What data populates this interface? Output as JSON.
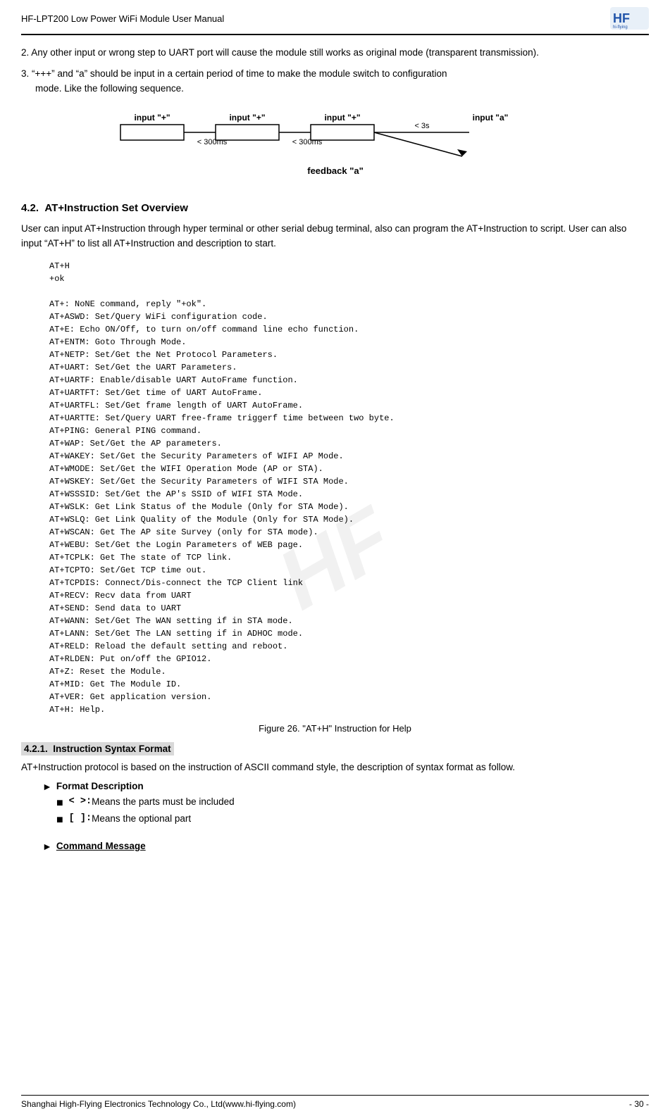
{
  "header": {
    "title": "HF-LPT200 Low Power WiFi Module User Manual",
    "logo_alt": "HF logo"
  },
  "footer": {
    "company": "Shanghai High-Flying Electronics Technology Co., Ltd(www.hi-flying.com)",
    "page": "- 30 -"
  },
  "watermark": "HF",
  "body": {
    "para1": "2. Any other input or wrong step to UART port will cause the module still works as original mode (transparent transmission).",
    "para2_a": "3. “+++” and “a” should be input in a certain period of time to make the module switch to configuration",
    "para2_b": "mode. Like the following sequence.",
    "section_4_2_number": "4.2.",
    "section_4_2_title": "AT+Instruction Set Overview",
    "section_4_2_body": "User can input AT+Instruction through hyper terminal or other serial debug terminal, also can program the AT+Instruction to script. User can also input “AT+H” to list all AT+Instruction and description to start.",
    "code_header": "AT+H\n+ok",
    "code_body": "\nAT+: NoNE command, reply \"+ok\".\nAT+ASWD: Set/Query WiFi configuration code.\nAT+E: Echo ON/Off, to turn on/off command line echo function.\nAT+ENTM: Goto Through Mode.\nAT+NETP: Set/Get the Net Protocol Parameters.\nAT+UART: Set/Get the UART Parameters.\nAT+UARTF: Enable/disable UART AutoFrame function.\nAT+UARTFT: Set/Get time of UART AutoFrame.\nAT+UARTFL: Set/Get frame length of UART AutoFrame.\nAT+UARTTE: Set/Query UART free-frame triggerf time between two byte.\nAT+PING: General PING command.\nAT+WAP: Set/Get the AP parameters.\nAT+WAKEY: Set/Get the Security Parameters of WIFI AP Mode.\nAT+WMODE: Set/Get the WIFI Operation Mode (AP or STA).\nAT+WSKEY: Set/Get the Security Parameters of WIFI STA Mode.\nAT+WSSSID: Set/Get the AP's SSID of WIFI STA Mode.\nAT+WSLK: Get Link Status of the Module (Only for STA Mode).\nAT+WSLQ: Get Link Quality of the Module (Only for STA Mode).\nAT+WSCAN: Get The AP site Survey (only for STA mode).\nAT+WEBU: Set/Get the Login Parameters of WEB page.\nAT+TCPLK: Get The state of TCP link.\nAT+TCPTO: Set/Get TCP time out.\nAT+TCPDIS: Connect/Dis-connect the TCP Client link\nAT+RECV: Recv data from UART\nAT+SEND: Send data to UART\nAT+WANN: Set/Get The WAN setting if in STA mode.\nAT+LANN: Set/Get The LAN setting if in ADHOC mode.\nAT+RELD: Reload the default setting and reboot.\nAT+RLDEN: Put on/off the GPIO12.\nAT+Z: Reset the Module.\nAT+MID: Get The Module ID.\nAT+VER: Get application version.\nAT+H: Help.",
    "figure_caption": "Figure 26.   \"AT+H\" Instruction for Help",
    "subsection_421_label": "4.2.1.",
    "subsection_421_title": "Instruction Syntax Format",
    "subsection_body": "AT+Instruction protocol is based on the instruction of ASCII command style, the description of syntax format as follow.",
    "format_desc_label": "Format Description",
    "bullet1_symbol": "< >:",
    "bullet1_text": "Means the parts must be included",
    "bullet2_symbol": "[ ]:",
    "bullet2_text": "Means the optional part",
    "command_message_label": "Command Message",
    "diagram": {
      "labels": [
        "input \"+\"",
        "input \"+\"",
        "input \"+\"",
        "input \"a\""
      ],
      "sublabels": [
        "< 300ms",
        "< 300ms",
        "< 3s",
        ""
      ],
      "feedback": "feedback \"a\""
    }
  }
}
